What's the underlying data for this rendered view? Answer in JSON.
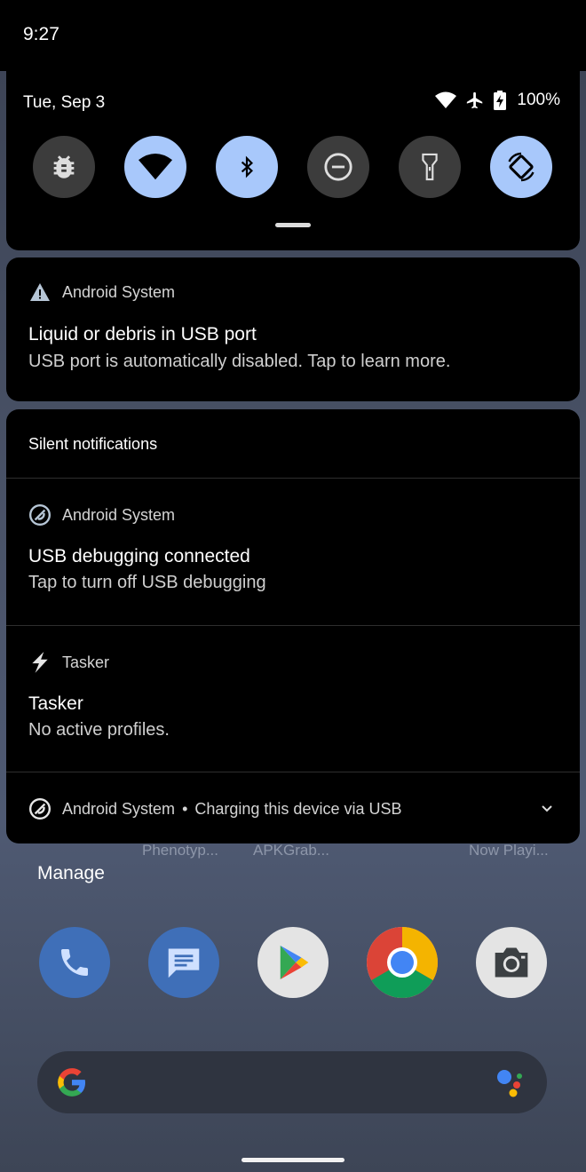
{
  "status_bar": {
    "time": "9:27"
  },
  "quick_settings": {
    "date": "Tue, Sep 3",
    "battery_percent": "100%",
    "status_icons": [
      "wifi-icon",
      "airplane-icon",
      "battery-charging-icon"
    ],
    "tiles": [
      {
        "name": "bug-report-tile",
        "icon": "bug-icon",
        "active": false
      },
      {
        "name": "wifi-tile",
        "icon": "wifi-icon",
        "active": true
      },
      {
        "name": "bluetooth-tile",
        "icon": "bluetooth-icon",
        "active": true
      },
      {
        "name": "do-not-disturb-tile",
        "icon": "do-not-disturb-icon",
        "active": false
      },
      {
        "name": "flashlight-tile",
        "icon": "flashlight-icon",
        "active": false
      },
      {
        "name": "auto-rotate-tile",
        "icon": "auto-rotate-icon",
        "active": true
      }
    ],
    "active_tile_color": "#a8c8fb",
    "inactive_tile_color": "#3c3c3c"
  },
  "alert_notification": {
    "app": "Android System",
    "icon": "warning-icon",
    "title": "Liquid or debris in USB port",
    "text": "USB port is automatically disabled. Tap to learn more."
  },
  "silent_section": {
    "title": "Silent notifications",
    "notifications": [
      {
        "app": "Android System",
        "icon": "android-system-icon",
        "title": "USB debugging connected",
        "text": "Tap to turn off USB debugging"
      },
      {
        "app": "Tasker",
        "icon": "tasker-bolt-icon",
        "title": "Tasker",
        "text": "No active profiles."
      }
    ],
    "collapsed": {
      "app": "Android System",
      "separator": "•",
      "text": "Charging this device via USB",
      "icon": "android-system-icon"
    }
  },
  "home": {
    "app_labels": [
      "Phenotyp...",
      "APKGrab...",
      "Now Playi..."
    ],
    "manage_label": "Manage",
    "dock": [
      "phone-icon",
      "messages-icon",
      "play-store-icon",
      "chrome-icon",
      "camera-icon"
    ],
    "search_icons": [
      "google-g-icon",
      "assistant-icon"
    ]
  }
}
